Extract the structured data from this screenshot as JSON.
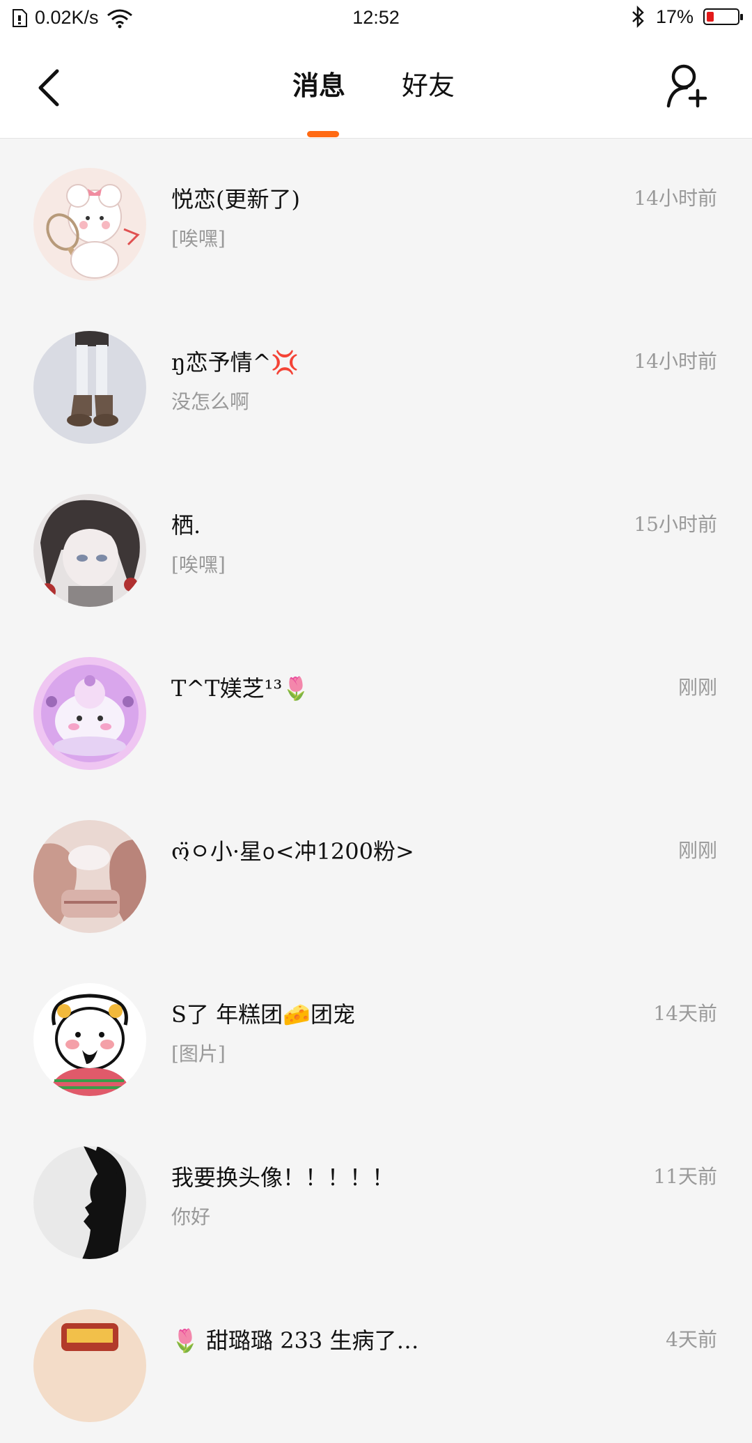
{
  "status_bar": {
    "network_speed": "0.02K/s",
    "time": "12:52",
    "battery": "17%",
    "battery_level": 0.17
  },
  "header": {
    "tabs": [
      {
        "label": "消息",
        "active": true
      },
      {
        "label": "好友",
        "active": false
      }
    ],
    "accent_color": "#ff6a13"
  },
  "conversations": [
    {
      "name": "悦恋(更新了)",
      "preview": "[唉嘿]",
      "time": "14小时前"
    },
    {
      "name": "ŋ恋予情^💢",
      "preview": "没怎么啊",
      "time": "14小时前"
    },
    {
      "name": "栖.",
      "preview": "[唉嘿]",
      "time": "15小时前"
    },
    {
      "name": "T^T媄芝¹³🌷",
      "preview": "",
      "time": "刚刚"
    },
    {
      "name": "ო̈ㅇ小·星ᩅ<冲1200粉>",
      "preview": "",
      "time": "刚刚"
    },
    {
      "name": "S了  年糕团🧀团宠",
      "preview": "[图片]",
      "time": "14天前"
    },
    {
      "name": "我要换头像！！！！！",
      "preview": "你好",
      "time": "11天前"
    },
    {
      "name": "🌷 甜璐璐 233 生病了…",
      "preview": "",
      "time": "4天前"
    }
  ]
}
